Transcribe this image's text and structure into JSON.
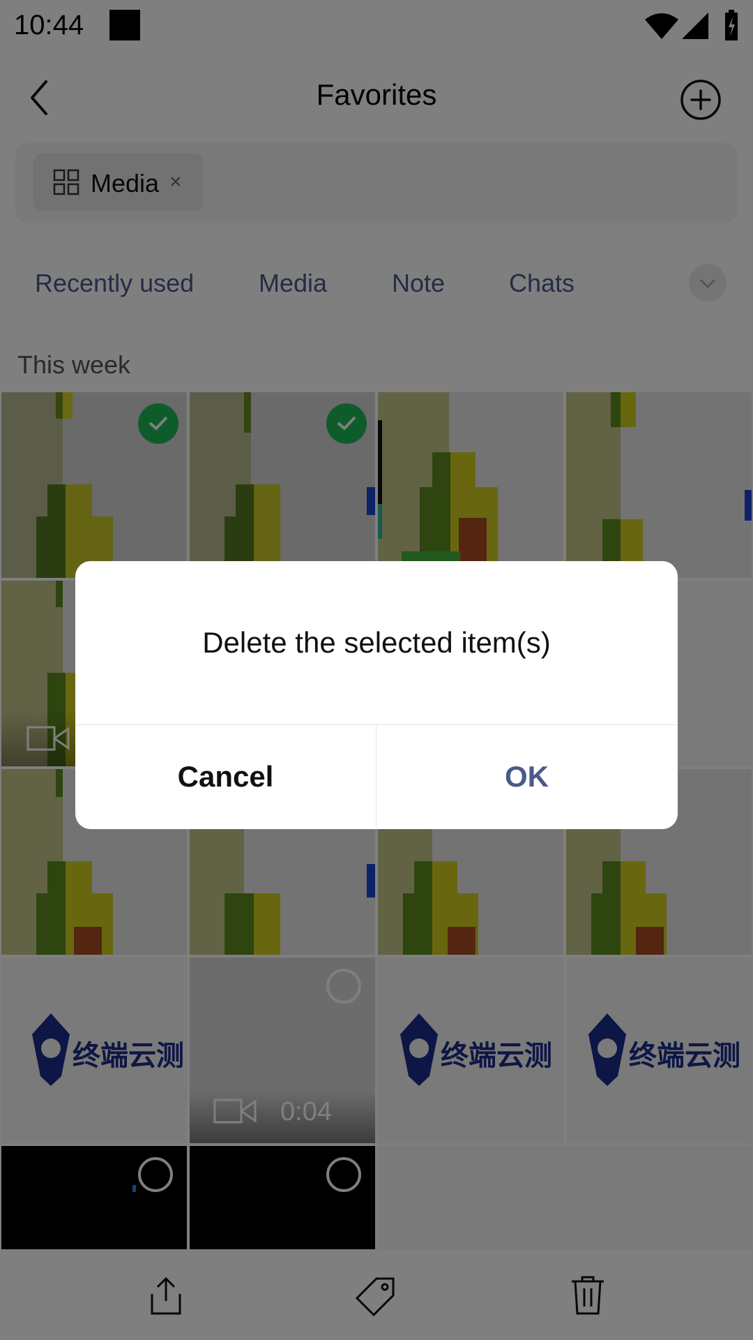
{
  "status_bar": {
    "time": "10:44"
  },
  "header": {
    "title": "Favorites"
  },
  "search": {
    "chip_label": "Media",
    "chip_close": "×"
  },
  "tabs": [
    {
      "label": "Recently used"
    },
    {
      "label": "Media"
    },
    {
      "label": "Note"
    },
    {
      "label": "Chats"
    }
  ],
  "section": {
    "label": "This week"
  },
  "grid": {
    "logo_text": "终端云测",
    "video_duration": "0:04"
  },
  "dialog": {
    "message": "Delete the selected item(s)",
    "cancel_label": "Cancel",
    "ok_label": "OK"
  },
  "colors": {
    "accent_ok": "#4a5a8a",
    "selected_check": "#1db954",
    "tab_text": "#4a5a8a"
  },
  "icons": {
    "back": "chevron-left-icon",
    "add": "plus-circle-icon",
    "chip": "grid-icon",
    "share": "share-icon",
    "tag": "tag-icon",
    "delete": "trash-icon",
    "video": "video-camera-icon"
  }
}
